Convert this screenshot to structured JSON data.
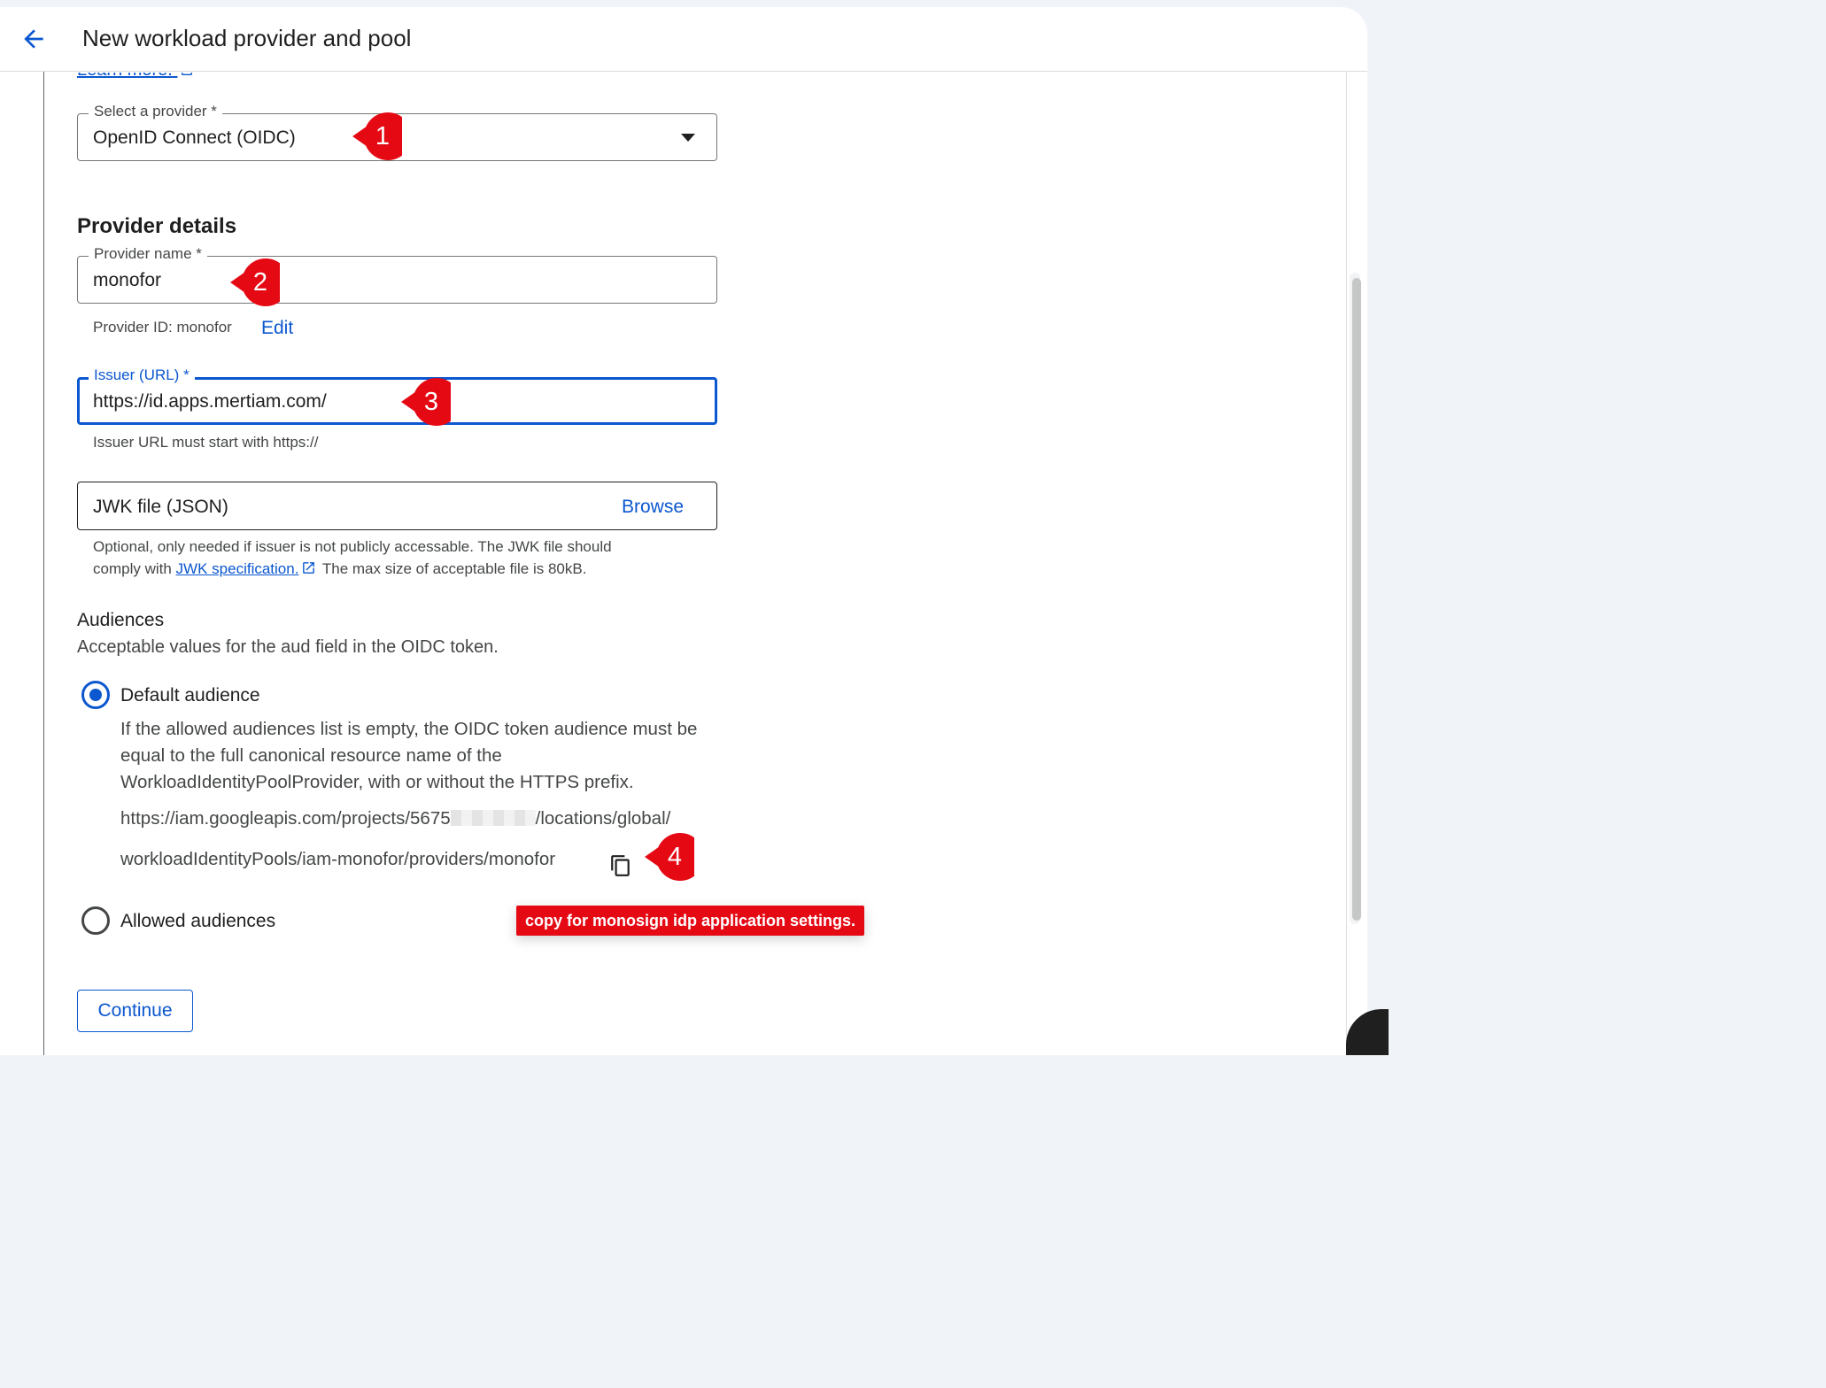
{
  "header": {
    "title": "New workload provider and pool"
  },
  "learn_more": {
    "text": "Learn more."
  },
  "provider_select": {
    "label": "Select a provider *",
    "value": "OpenID Connect (OIDC)"
  },
  "provider_details": {
    "heading": "Provider details",
    "name_field": {
      "label": "Provider name *",
      "value": "monofor"
    },
    "provider_id_text": "Provider ID: monofor",
    "edit_label": "Edit",
    "issuer_field": {
      "label": "Issuer (URL) *",
      "value": "https://id.apps.mertiam.com/"
    },
    "issuer_helper": "Issuer URL must start with https://",
    "jwk": {
      "label": "JWK file (JSON)",
      "browse_label": "Browse",
      "helper_line1": "Optional, only needed if issuer is not publicly accessable. The JWK file should",
      "helper_prefix": "comply with",
      "helper_link": "JWK specification.",
      "helper_suffix": "The max size of acceptable file is 80kB."
    }
  },
  "audiences": {
    "heading": "Audiences",
    "description": "Acceptable values for the aud field in the OIDC token.",
    "default": {
      "label": "Default audience",
      "checked": true,
      "description": "If the allowed audiences list is empty, the OIDC token audience must be equal to the full canonical resource name of the WorkloadIdentityPoolProvider, with or without the HTTPS prefix.",
      "resource_part1": "https://iam.googleapis.com/projects/5675",
      "resource_part2": "/locations/global/",
      "resource_line2": "workloadIdentityPools/iam-monofor/providers/monofor"
    },
    "allowed": {
      "label": "Allowed audiences",
      "checked": false
    }
  },
  "continue_label": "Continue",
  "annotations": {
    "badges": [
      "1",
      "2",
      "3",
      "4"
    ],
    "note": "copy for monosign idp application settings.",
    "color": "#e50914"
  },
  "colors": {
    "accent": "#0b57d0",
    "text": "#1f1f1f",
    "muted": "#444746"
  }
}
